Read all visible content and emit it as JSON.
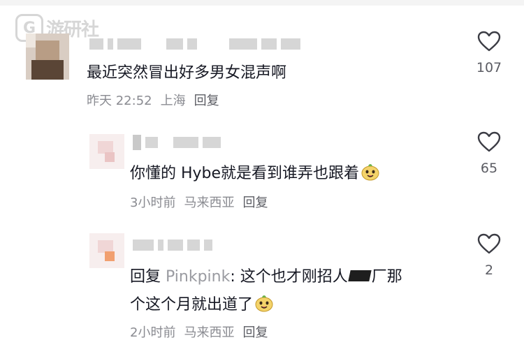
{
  "watermark": {
    "text": "游研社"
  },
  "comments": [
    {
      "text": "最近突然冒出好多男女混声啊",
      "time": "昨天 22:52",
      "location": "上海",
      "reply_label": "回复",
      "likes": "107"
    },
    {
      "text": "你懂的 Hybe就是看到谁弄也跟着",
      "time": "3小时前",
      "location": "马来西亚",
      "reply_label": "回复",
      "likes": "65"
    },
    {
      "reply_prefix": "回复",
      "mention": "Pinkpink",
      "text_line1": ": 这个也才刚招人",
      "text_line1_end": "厂那",
      "text_line2": "个这个月就出道了",
      "time": "2小时前",
      "location": "马来西亚",
      "reply_label": "回复",
      "likes": "2"
    }
  ],
  "icons": {
    "like": "heart-outline-icon",
    "emoji": "smiling-face-emoji-icon",
    "redaction": "redacted-block"
  },
  "colors": {
    "text": "#161823",
    "meta": "#8a8b91",
    "mention": "#9a9ba1",
    "heart_stroke": "#3b3c44"
  }
}
